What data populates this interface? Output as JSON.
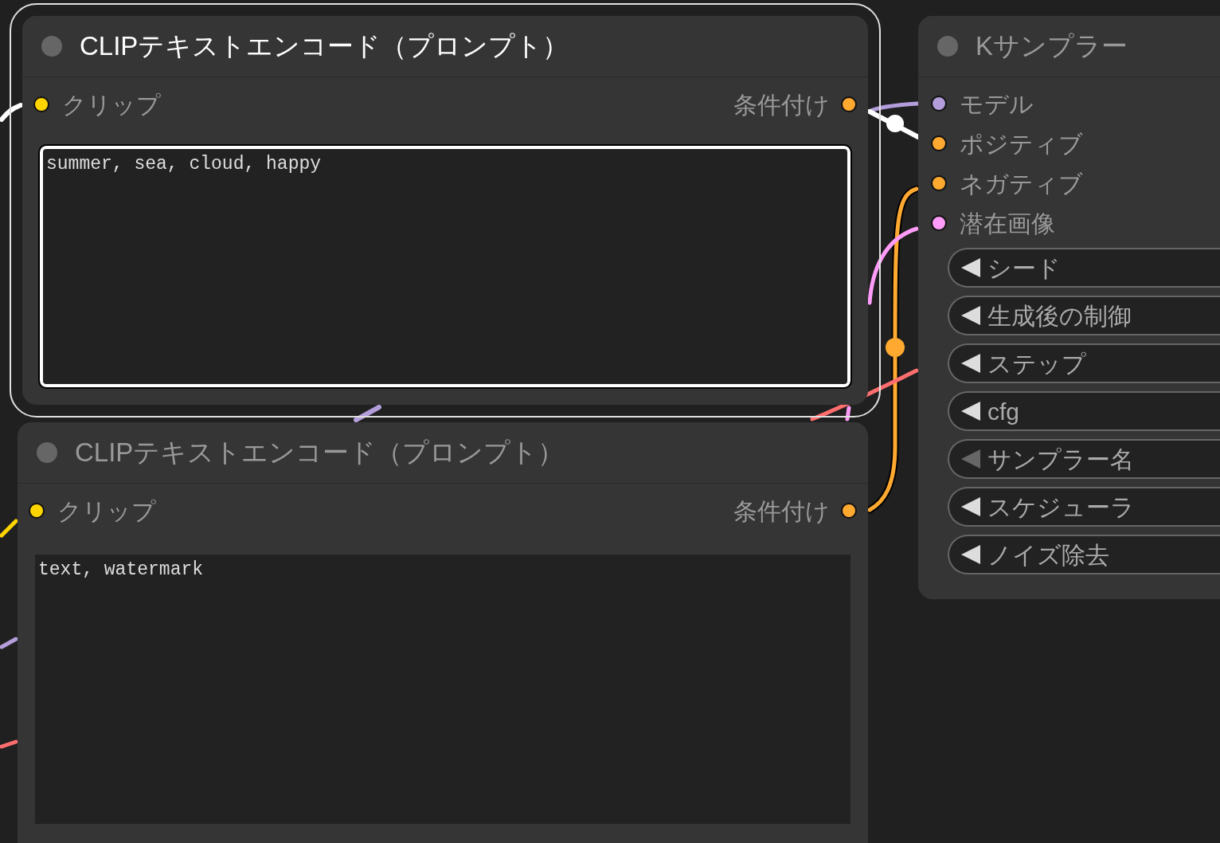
{
  "nodes": [
    {
      "kind": "text_encode",
      "title": "CLIPテキストエンコード（プロンプト）",
      "selected": true,
      "inputs": [
        {
          "label": "クリップ",
          "color": "#ffd500"
        }
      ],
      "outputs": [
        {
          "label": "条件付け",
          "color": "#ffa931"
        }
      ],
      "prompt": {
        "value": "summer, sea, cloud, happy",
        "focused": true
      }
    },
    {
      "kind": "text_encode",
      "title": "CLIPテキストエンコード（プロンプト）",
      "selected": false,
      "inputs": [
        {
          "label": "クリップ",
          "color": "#ffd500"
        }
      ],
      "outputs": [
        {
          "label": "条件付け",
          "color": "#ffa931"
        }
      ],
      "prompt": {
        "value": "text, watermark",
        "focused": false
      }
    },
    {
      "kind": "sampler",
      "title": "Kサンプラー",
      "selected": false,
      "inputs": [
        {
          "label": "モデル",
          "color": "#b39ddb"
        },
        {
          "label": "ポジティブ",
          "color": "#ffa931"
        },
        {
          "label": "ネガティブ",
          "color": "#ffa931"
        },
        {
          "label": "潜在画像",
          "color": "#ff9cf9"
        }
      ],
      "widgets": [
        {
          "label": "シード",
          "disabled": false
        },
        {
          "label": "生成後の制御",
          "disabled": false
        },
        {
          "label": "ステップ",
          "disabled": false
        },
        {
          "label": "cfg",
          "disabled": false
        },
        {
          "label": "サンプラー名",
          "disabled": true
        },
        {
          "label": "スケジューラ",
          "disabled": false
        },
        {
          "label": "ノイズ除去",
          "disabled": false
        }
      ]
    }
  ]
}
